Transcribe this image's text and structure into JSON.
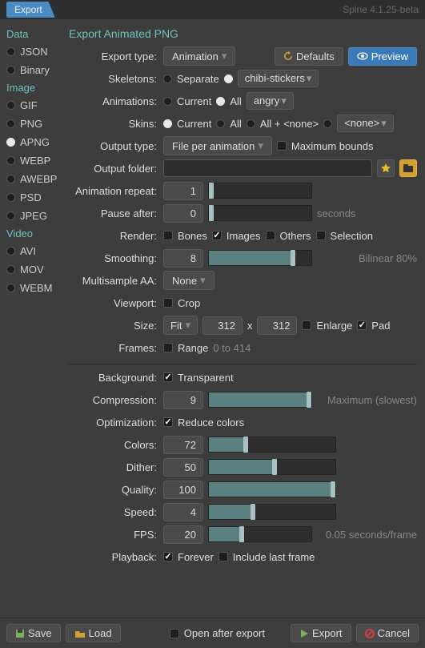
{
  "app": {
    "tab": "Export",
    "name": "Spine 4.1.25-beta"
  },
  "sidebar": {
    "cats": [
      {
        "h": "Data",
        "items": [
          {
            "l": "JSON",
            "s": false
          },
          {
            "l": "Binary",
            "s": false
          }
        ]
      },
      {
        "h": "Image",
        "items": [
          {
            "l": "GIF",
            "s": false
          },
          {
            "l": "PNG",
            "s": false
          },
          {
            "l": "APNG",
            "s": true
          },
          {
            "l": "WEBP",
            "s": false
          },
          {
            "l": "AWEBP",
            "s": false
          },
          {
            "l": "PSD",
            "s": false
          },
          {
            "l": "JPEG",
            "s": false
          }
        ]
      },
      {
        "h": "Video",
        "items": [
          {
            "l": "AVI",
            "s": false
          },
          {
            "l": "MOV",
            "s": false
          },
          {
            "l": "WEBM",
            "s": false
          }
        ]
      }
    ]
  },
  "main": {
    "title": "Export Animated PNG",
    "exportType": {
      "label": "Export type:",
      "value": "Animation",
      "defaults": "Defaults",
      "preview": "Preview"
    },
    "skeletons": {
      "label": "Skeletons:",
      "separate": "Separate",
      "tag": "chibi-stickers"
    },
    "animations": {
      "label": "Animations:",
      "current": "Current",
      "all": "All",
      "tag": "angry"
    },
    "skins": {
      "label": "Skins:",
      "current": "Current",
      "all": "All",
      "allnone": "All + <none>",
      "none": "<none>"
    },
    "outputType": {
      "label": "Output type:",
      "value": "File per animation",
      "maxbounds": "Maximum bounds"
    },
    "outputFolder": {
      "label": "Output folder:"
    },
    "animRepeat": {
      "label": "Animation repeat:",
      "value": "1"
    },
    "pauseAfter": {
      "label": "Pause after:",
      "value": "0",
      "unit": "seconds"
    },
    "render": {
      "label": "Render:",
      "bones": "Bones",
      "images": "Images",
      "others": "Others",
      "selection": "Selection"
    },
    "smoothing": {
      "label": "Smoothing:",
      "value": "8",
      "info": "Bilinear 80%"
    },
    "msaa": {
      "label": "Multisample AA:",
      "value": "None"
    },
    "viewport": {
      "label": "Viewport:",
      "crop": "Crop"
    },
    "size": {
      "label": "Size:",
      "fit": "Fit",
      "w": "312",
      "h": "312",
      "x": "x",
      "enlarge": "Enlarge",
      "pad": "Pad"
    },
    "frames": {
      "label": "Frames:",
      "range": "Range",
      "info": "0 to 414"
    },
    "background": {
      "label": "Background:",
      "transparent": "Transparent"
    },
    "compression": {
      "label": "Compression:",
      "value": "9",
      "info": "Maximum (slowest)"
    },
    "optimization": {
      "label": "Optimization:",
      "reduce": "Reduce colors"
    },
    "colors": {
      "label": "Colors:",
      "value": "72"
    },
    "dither": {
      "label": "Dither:",
      "value": "50"
    },
    "quality": {
      "label": "Quality:",
      "value": "100"
    },
    "speed": {
      "label": "Speed:",
      "value": "4"
    },
    "fps": {
      "label": "FPS:",
      "value": "20",
      "info": "0.05 seconds/frame"
    },
    "playback": {
      "label": "Playback:",
      "forever": "Forever",
      "last": "Include last frame"
    }
  },
  "footer": {
    "save": "Save",
    "load": "Load",
    "open": "Open after export",
    "export": "Export",
    "cancel": "Cancel"
  }
}
